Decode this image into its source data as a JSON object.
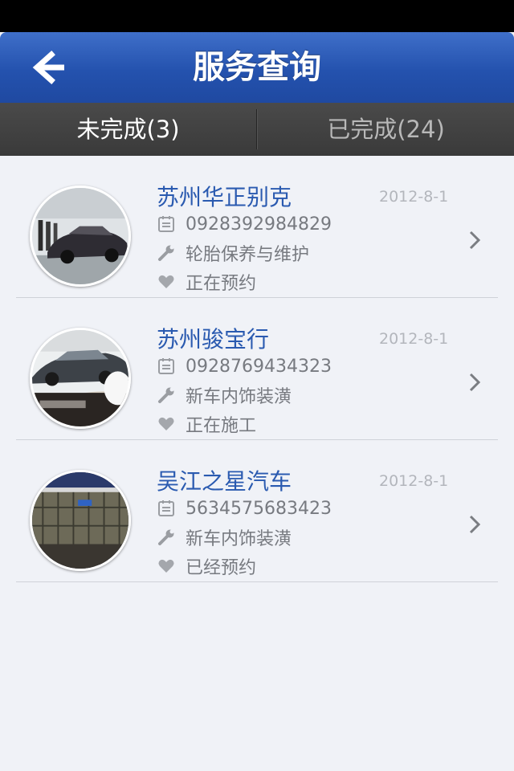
{
  "header": {
    "title": "服务查询"
  },
  "tabs": [
    {
      "label": "未完成(3)",
      "active": true
    },
    {
      "label": "已完成(24)",
      "active": false
    }
  ],
  "items": [
    {
      "name": "苏州华正别克",
      "date": "2012-8-1",
      "phone": "0928392984829",
      "service": "轮胎保养与维护",
      "status": "正在预约",
      "thumb": "sedan-showroom"
    },
    {
      "name": "苏州骏宝行",
      "date": "2012-8-1",
      "phone": "0928769434323",
      "service": "新车内饰装潢",
      "status": "正在施工",
      "thumb": "bmw-showroom"
    },
    {
      "name": "吴江之星汽车",
      "date": "2012-8-1",
      "phone": "5634575683423",
      "service": "新车内饰装潢",
      "status": "已经预约",
      "thumb": "dealership-building"
    }
  ],
  "icons": {
    "back": "arrow-left-icon",
    "phone": "notepad-icon",
    "service": "wrench-icon",
    "status": "heart-icon",
    "detail": "chevron-right-icon"
  },
  "colors": {
    "nav": "#2452ae",
    "title_text": "#2a5ab0",
    "tabbar": "#3f3f3f",
    "background": "#f0f2f7"
  }
}
